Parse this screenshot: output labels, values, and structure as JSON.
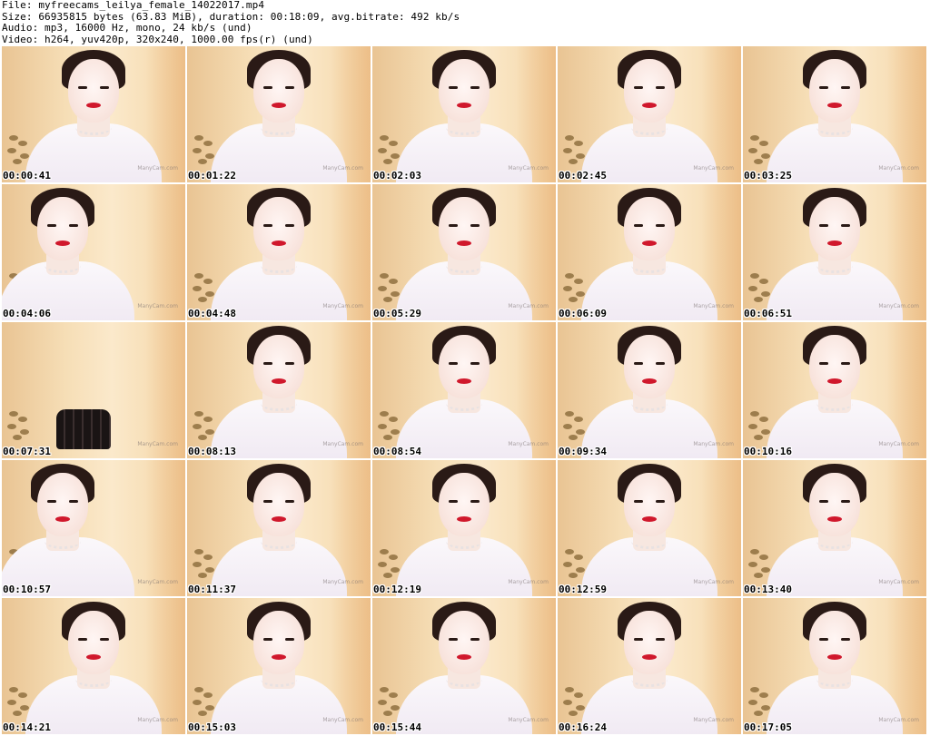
{
  "header": {
    "file": "File: myfreecams_leilya_female_14022017.mp4",
    "size": "Size: 66935815 bytes (63.83 MiB), duration: 00:18:09, avg.bitrate: 492 kb/s",
    "audio": "Audio: mp3, 16000 Hz, mono, 24 kb/s (und)",
    "video": "Video: h264, yuv420p, 320x240, 1000.00 fps(r) (und)"
  },
  "thumbnails": [
    {
      "time": "00:00:41",
      "pose": "center"
    },
    {
      "time": "00:01:22",
      "pose": "center"
    },
    {
      "time": "00:02:03",
      "pose": "center"
    },
    {
      "time": "00:02:45",
      "pose": "center"
    },
    {
      "time": "00:03:25",
      "pose": "center"
    },
    {
      "time": "00:04:06",
      "pose": "shifted-left"
    },
    {
      "time": "00:04:48",
      "pose": "center"
    },
    {
      "time": "00:05:29",
      "pose": "center"
    },
    {
      "time": "00:06:09",
      "pose": "center"
    },
    {
      "time": "00:06:51",
      "pose": "center"
    },
    {
      "time": "00:07:31",
      "pose": "empty"
    },
    {
      "time": "00:08:13",
      "pose": "center"
    },
    {
      "time": "00:08:54",
      "pose": "center"
    },
    {
      "time": "00:09:34",
      "pose": "center"
    },
    {
      "time": "00:10:16",
      "pose": "center"
    },
    {
      "time": "00:10:57",
      "pose": "shifted-left"
    },
    {
      "time": "00:11:37",
      "pose": "center"
    },
    {
      "time": "00:12:19",
      "pose": "center"
    },
    {
      "time": "00:12:59",
      "pose": "center"
    },
    {
      "time": "00:13:40",
      "pose": "center"
    },
    {
      "time": "00:14:21",
      "pose": "center"
    },
    {
      "time": "00:15:03",
      "pose": "center"
    },
    {
      "time": "00:15:44",
      "pose": "center"
    },
    {
      "time": "00:16:24",
      "pose": "center"
    },
    {
      "time": "00:17:05",
      "pose": "center"
    }
  ],
  "watermark": "ManyCam.com"
}
